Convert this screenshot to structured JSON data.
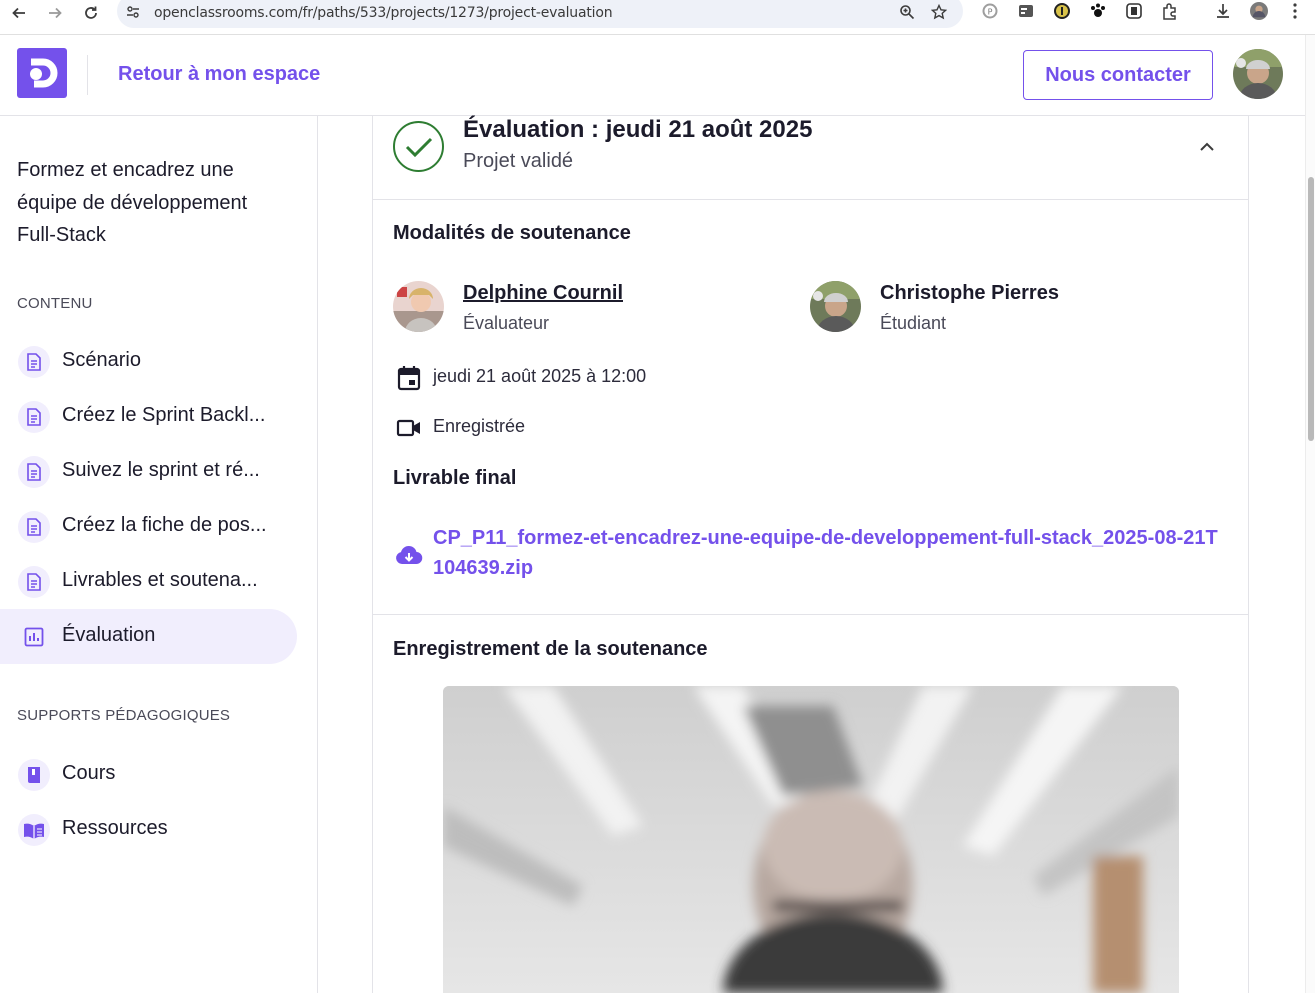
{
  "browser": {
    "url": "openclassrooms.com/fr/paths/533/projects/1273/project-evaluation",
    "icons": [
      "back-arrow-icon",
      "forward-arrow-icon",
      "reload-icon",
      "site-settings-icon",
      "zoom-icon",
      "bookmark-star-icon",
      "download-icon",
      "extensions-icon",
      "menu-kebab-icon"
    ]
  },
  "appbar": {
    "back_label": "Retour à mon espace",
    "contact_label": "Nous contacter",
    "brand_color": "#7451eb"
  },
  "sidebar": {
    "path_title": "Formez et encadrez une équipe de développement Full-Stack",
    "content_label": "CONTENU",
    "content_items": [
      {
        "label": "Scénario",
        "icon": "document-icon"
      },
      {
        "label": "Créez le Sprint Backl...",
        "icon": "document-icon"
      },
      {
        "label": "Suivez le sprint et ré...",
        "icon": "document-icon"
      },
      {
        "label": "Créez la fiche de pos...",
        "icon": "document-icon"
      },
      {
        "label": "Livrables et soutena...",
        "icon": "document-icon"
      },
      {
        "label": "Évaluation",
        "icon": "bar-chart-icon",
        "active": true
      }
    ],
    "resources_label": "SUPPORTS PÉDAGOGIQUES",
    "resource_items": [
      {
        "label": "Cours",
        "icon": "book-icon"
      },
      {
        "label": "Ressources",
        "icon": "open-book-icon"
      }
    ]
  },
  "evaluation": {
    "title": "Évaluation : jeudi 21 août 2025",
    "status": "Projet validé",
    "status_color": "#2e7d32",
    "modalities_heading": "Modalités de soutenance",
    "evaluator": {
      "name": "Delphine Cournil",
      "role": "Évaluateur"
    },
    "student": {
      "name": "Christophe Pierres",
      "role": "Étudiant"
    },
    "datetime": "jeudi 21 août 2025 à 12:00",
    "recording_status": "Enregistrée",
    "deliverable_heading": "Livrable final",
    "deliverable_file": "CP_P11_formez-et-encadrez-une-equipe-de-developpement-full-stack_2025-08-21T104639.zip",
    "recording_heading": "Enregistrement de la soutenance"
  }
}
